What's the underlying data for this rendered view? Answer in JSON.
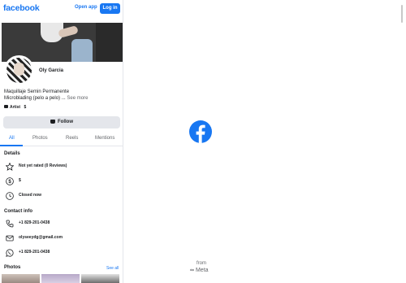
{
  "header": {
    "brand": "facebook",
    "open_app_label": "Open app",
    "login_label": "Log in"
  },
  "profile": {
    "name": "Oly Garcia",
    "bio_line1": "Maquillaje Semin Permanente",
    "bio_line2": "Microblading (pelo a pelo) ...",
    "see_more": "See more",
    "category": "Artist",
    "price": "$",
    "follow_label": "Follow"
  },
  "tabs": [
    {
      "label": "All",
      "active": true
    },
    {
      "label": "Photos",
      "active": false
    },
    {
      "label": "Reels",
      "active": false
    },
    {
      "label": "Mentions",
      "active": false
    }
  ],
  "details": {
    "title": "Details",
    "rating": "Not yet rated (0 Reviews)",
    "price_range": "$",
    "hours": "Closed now"
  },
  "contact": {
    "title": "Contact info",
    "phone": "+1 829-201-0438",
    "email": "olyseeydg@gmail.com",
    "whatsapp": "+1 829-201-0438"
  },
  "photos": {
    "title": "Photos",
    "see_all": "See all"
  },
  "footer": {
    "from_label": "from",
    "meta_label": "Meta"
  },
  "colors": {
    "brand_blue": "#1877f2",
    "button_gray": "#e4e6eb",
    "secondary_text": "#65676b"
  }
}
